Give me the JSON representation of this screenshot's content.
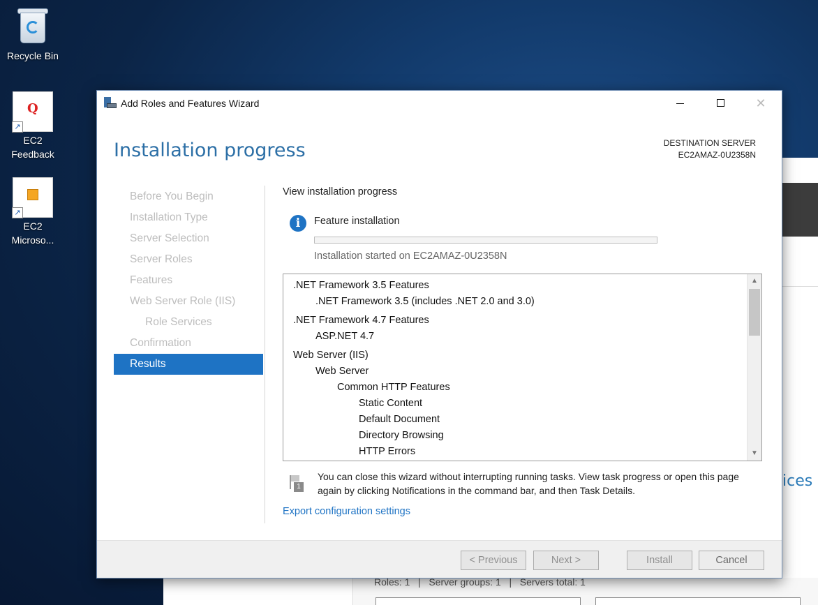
{
  "desktop": {
    "icons": [
      {
        "label": "Recycle Bin"
      },
      {
        "label": "EC2 Feedback",
        "glyph": "Q"
      },
      {
        "label": "EC2 Microso...",
        "glyph": "▣"
      }
    ]
  },
  "background_window": {
    "services_fragment": "vices",
    "status_line": "Roles: 1   |   Server groups: 1   |   Servers total: 1"
  },
  "dialog": {
    "title": "Add Roles and Features Wizard",
    "heading": "Installation progress",
    "destination_label": "DESTINATION SERVER",
    "destination_server": "EC2AMAZ-0U2358N",
    "nav": [
      {
        "label": "Before You Begin",
        "state": "disabled"
      },
      {
        "label": "Installation Type",
        "state": "disabled"
      },
      {
        "label": "Server Selection",
        "state": "disabled"
      },
      {
        "label": "Server Roles",
        "state": "disabled"
      },
      {
        "label": "Features",
        "state": "disabled"
      },
      {
        "label": "Web Server Role (IIS)",
        "state": "disabled"
      },
      {
        "label": "Role Services",
        "state": "disabled",
        "indent": 1
      },
      {
        "label": "Confirmation",
        "state": "disabled"
      },
      {
        "label": "Results",
        "state": "active"
      }
    ],
    "content": {
      "subtitle": "View installation progress",
      "feature_label": "Feature installation",
      "progress_fraction": 0.0,
      "started_text": "Installation started on EC2AMAZ-0U2358N",
      "features": [
        {
          "text": ".NET Framework 3.5 Features",
          "level": 0
        },
        {
          "text": ".NET Framework 3.5 (includes .NET 2.0 and 3.0)",
          "level": 1
        },
        {
          "text": ".NET Framework 4.7 Features",
          "level": 0
        },
        {
          "text": "ASP.NET 4.7",
          "level": 1
        },
        {
          "text": "Web Server (IIS)",
          "level": 0
        },
        {
          "text": "Web Server",
          "level": 1
        },
        {
          "text": "Common HTTP Features",
          "level": 2
        },
        {
          "text": "Static Content",
          "level": 3
        },
        {
          "text": "Default Document",
          "level": 3
        },
        {
          "text": "Directory Browsing",
          "level": 3
        },
        {
          "text": "HTTP Errors",
          "level": 3
        }
      ],
      "note": "You can close this wizard without interrupting running tasks. View task progress or open this page again by clicking Notifications in the command bar, and then Task Details.",
      "note_badge": "1",
      "export_link": "Export configuration settings"
    },
    "buttons": {
      "previous": "< Previous",
      "next": "Next >",
      "install": "Install",
      "cancel": "Cancel"
    },
    "colors": {
      "accent": "#1e73c4",
      "heading": "#2c6fa6"
    }
  }
}
